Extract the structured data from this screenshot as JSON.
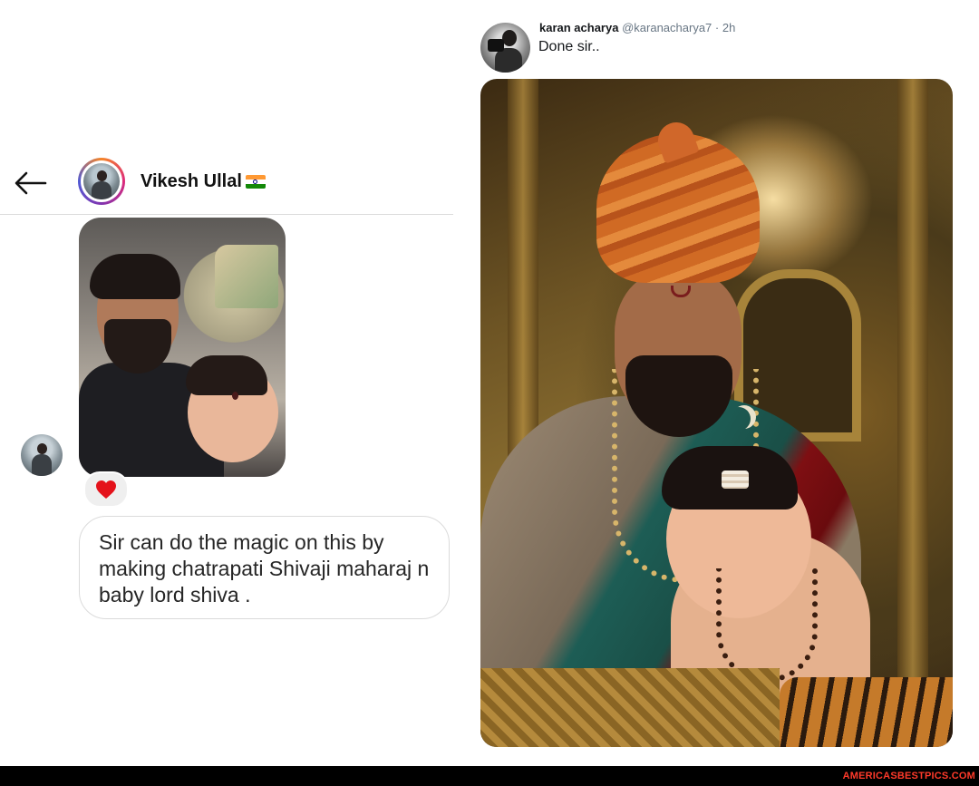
{
  "dm": {
    "contact_name": "Vikesh Ullal",
    "reaction": "heart",
    "message_text": "Sir can do the magic on this by making chatrapati Shivaji maharaj n baby lord shiva ."
  },
  "tweet": {
    "display_name": "karan acharya",
    "handle": "@karanacharya7",
    "separator": "·",
    "time": "2h",
    "text": "Done sir.."
  },
  "footer": {
    "brand": "AMERICASBESTPICS.COM"
  },
  "colors": {
    "story_ring": [
      "#f58529",
      "#dd2a7b",
      "#8134af",
      "#515bd4"
    ],
    "heart": "#e4121b",
    "footer_brand": "#ff3a2a"
  },
  "icons": [
    "back-arrow-icon",
    "heart-icon",
    "india-flag-icon"
  ]
}
